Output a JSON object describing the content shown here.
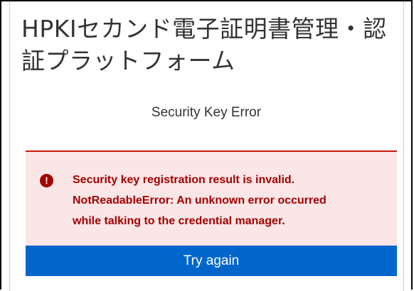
{
  "header": {
    "title": "HPKIセカンド電子証明書管理・認証プラットフォーム"
  },
  "main": {
    "heading": "Security Key Error",
    "alert": {
      "icon": "exclamation-circle-icon",
      "lines": [
        "Security key registration result is invalid.",
        "NotReadableError: An unknown error occurred",
        "while talking to the credential manager."
      ],
      "color": "#a30000",
      "background": "#fae6e6"
    },
    "try_again_label": "Try again"
  },
  "colors": {
    "primary_button": "#0066cc",
    "error": "#c9190b"
  }
}
